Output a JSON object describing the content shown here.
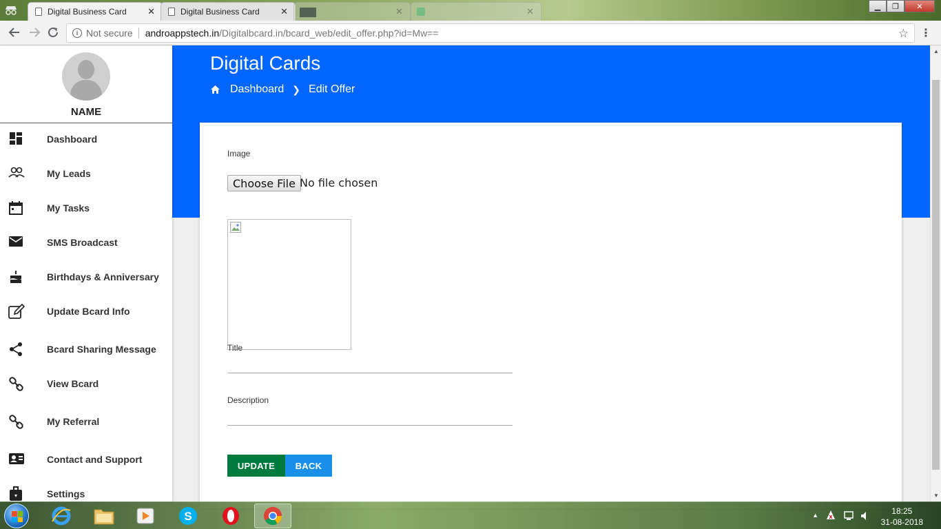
{
  "browser": {
    "tabs": [
      {
        "title": "Digital Business Card",
        "active": true
      },
      {
        "title": "Digital Business Card",
        "active": false
      },
      {
        "title": "",
        "active": false
      },
      {
        "title": "",
        "active": false
      }
    ],
    "close_glyph": "✕",
    "security_label": "Not secure",
    "url_host": "androappstech.in",
    "url_path": "/Digitalbcard.in/bcard_web/edit_offer.php?id=Mw=="
  },
  "sidebar": {
    "profile_name": "NAME",
    "items": [
      {
        "label": "Dashboard",
        "icon": "dashboard-icon"
      },
      {
        "label": "My Leads",
        "icon": "people-icon"
      },
      {
        "label": "My Tasks",
        "icon": "calendar-icon"
      },
      {
        "label": "SMS Broadcast",
        "icon": "envelope-icon"
      },
      {
        "label": "Birthdays & Anniversary",
        "icon": "cake-icon"
      },
      {
        "label": "Update Bcard Info",
        "icon": "edit-icon"
      },
      {
        "label": "Bcard Sharing Message",
        "icon": "share-icon"
      },
      {
        "label": "View Bcard",
        "icon": "link-icon"
      },
      {
        "label": "My Referral",
        "icon": "link-icon"
      },
      {
        "label": "Contact and Support",
        "icon": "contact-card-icon"
      },
      {
        "label": "Settings",
        "icon": "settings-icon"
      }
    ]
  },
  "header": {
    "title": "Digital Cards",
    "breadcrumb": [
      "Dashboard",
      "Edit Offer"
    ]
  },
  "form": {
    "image_label": "Image",
    "file_button": "Choose File",
    "file_status": "No file chosen",
    "title_label": "Title",
    "title_value": "",
    "description_label": "Description",
    "description_value": "",
    "update_button": "UPDATE",
    "back_button": "BACK"
  },
  "taskbar": {
    "apps": [
      "internet-explorer-icon",
      "file-explorer-icon",
      "media-player-icon",
      "skype-icon",
      "opera-icon",
      "chrome-icon"
    ],
    "time": "18:25",
    "date": "31-08-2018"
  },
  "colors": {
    "banner": "#0066ff",
    "update_button": "#007a3d",
    "back_button": "#1a8fe8"
  }
}
